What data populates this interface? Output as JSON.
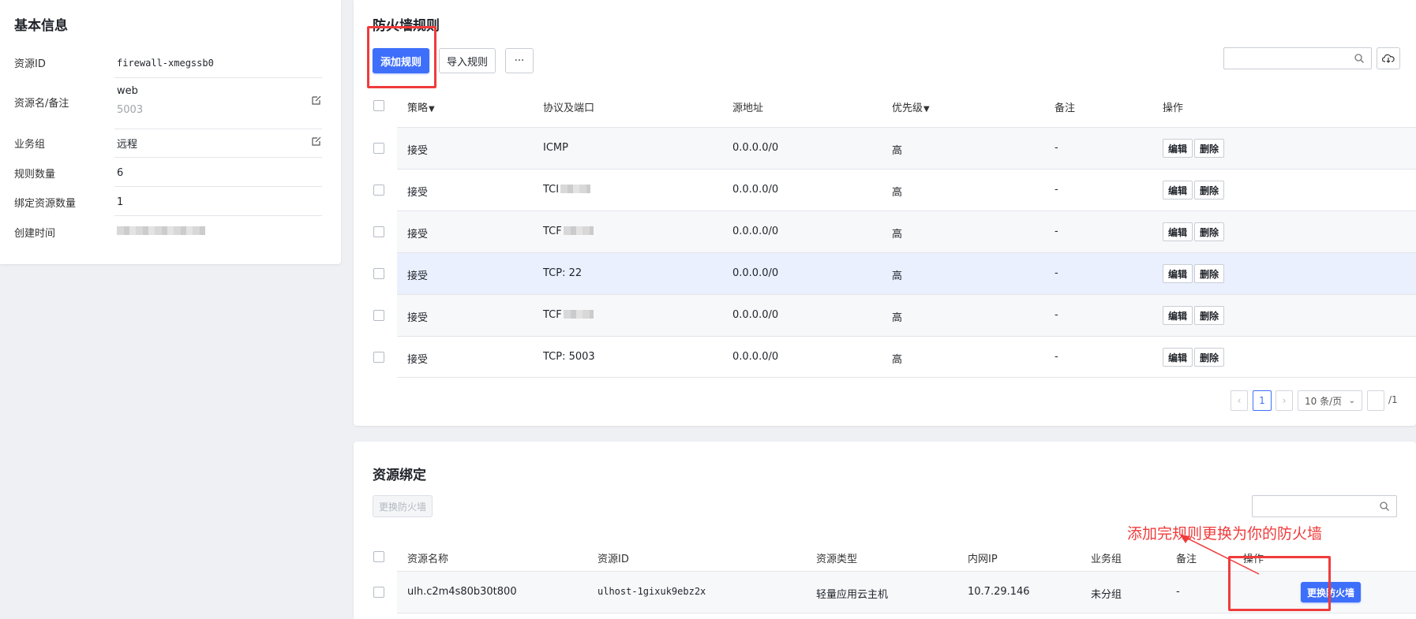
{
  "info": {
    "title": "基本信息",
    "rows": [
      {
        "key": "资源ID",
        "value": "firewall-xmegssb0"
      },
      {
        "key": "资源名/备注",
        "value": "web",
        "sub": "5003"
      },
      {
        "key": "业务组",
        "value": "远程"
      },
      {
        "key": "规则数量",
        "value": "6"
      },
      {
        "key": "绑定资源数量",
        "value": "1"
      },
      {
        "key": "创建时间",
        "value": ""
      }
    ]
  },
  "rules": {
    "title": "防火墙规则",
    "add_label": "添加规则",
    "import_label": "导入规则",
    "more_label": "···",
    "search_placeholder": "",
    "columns": [
      "策略",
      "协议及端口",
      "源地址",
      "优先级",
      "备注",
      "操作"
    ],
    "rows": [
      {
        "policy": "接受",
        "proto": "ICMP",
        "src": "0.0.0.0/0",
        "priority": "高",
        "note": "-",
        "blurred": false
      },
      {
        "policy": "接受",
        "proto": "TCI",
        "src": "0.0.0.0/0",
        "priority": "高",
        "note": "-",
        "blurred": true
      },
      {
        "policy": "接受",
        "proto": "TCF",
        "src": "0.0.0.0/0",
        "priority": "高",
        "note": "-",
        "blurred": true
      },
      {
        "policy": "接受",
        "proto": "TCP: 22",
        "src": "0.0.0.0/0",
        "priority": "高",
        "note": "-",
        "blurred": false
      },
      {
        "policy": "接受",
        "proto": "TCF",
        "src": "0.0.0.0/0",
        "priority": "高",
        "note": "-",
        "blurred": true
      },
      {
        "policy": "接受",
        "proto": "TCP: 5003",
        "src": "0.0.0.0/0",
        "priority": "高",
        "note": "-",
        "blurred": false
      }
    ],
    "edit_label": "编辑",
    "delete_label": "删除",
    "pagination": {
      "prev": "‹",
      "page": "1",
      "next": "›",
      "page_size": "10 条/页",
      "total_pages": "/1"
    }
  },
  "binding": {
    "title": "资源绑定",
    "change_label": "更换防火墙",
    "columns": [
      "资源名称",
      "资源ID",
      "资源类型",
      "内网IP",
      "业务组",
      "备注",
      "操作"
    ],
    "row": {
      "name": "ulh.c2m4s80b30t800",
      "id": "ulhost-1gixuk9ebz2x",
      "type": "轻量应用云主机",
      "ip": "10.7.29.146",
      "group": "未分组",
      "note": "-",
      "action": "更换防火墙"
    }
  },
  "annotation": "添加完规则更换为你的防火墙",
  "colors": {
    "accent": "#3e6ffb",
    "annotation": "#f03b3b",
    "highlight_row": "#eaf0fd"
  }
}
